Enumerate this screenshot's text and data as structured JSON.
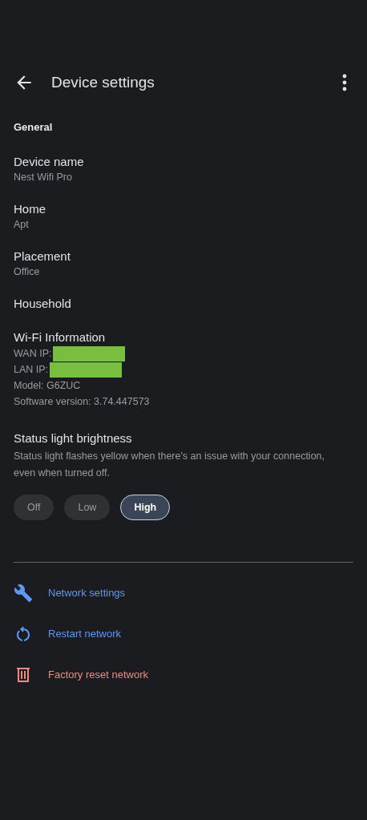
{
  "header": {
    "title": "Device settings"
  },
  "section": "General",
  "settings": [
    {
      "label": "Device name",
      "value": "Nest Wifi Pro"
    },
    {
      "label": "Home",
      "value": "Apt"
    },
    {
      "label": "Placement",
      "value": "Office"
    },
    {
      "label": "Household"
    }
  ],
  "wifi_info": {
    "title": "Wi-Fi Information",
    "lines": [
      {
        "label": "WAN IP:",
        "redacted": true
      },
      {
        "label": "LAN IP:",
        "redacted": true
      },
      {
        "label": "Model: G6ZUC",
        "redacted": false
      },
      {
        "label": "Software version: 3.74.447573",
        "redacted": false
      }
    ]
  },
  "brightness": {
    "title": "Status light brightness",
    "description": "Status light flashes yellow when there's an issue with your connection, even when turned off.",
    "options": [
      {
        "label": "Off",
        "selected": false
      },
      {
        "label": "Low",
        "selected": false
      },
      {
        "label": "High",
        "selected": true
      }
    ]
  },
  "actions": [
    {
      "kind": "wrench",
      "label": "Network settings",
      "color": "#5e97f6"
    },
    {
      "kind": "restart",
      "label": "Restart network",
      "color": "#5e97f6"
    },
    {
      "kind": "trash",
      "label": "Factory reset network",
      "color": "#ee8a80"
    }
  ]
}
